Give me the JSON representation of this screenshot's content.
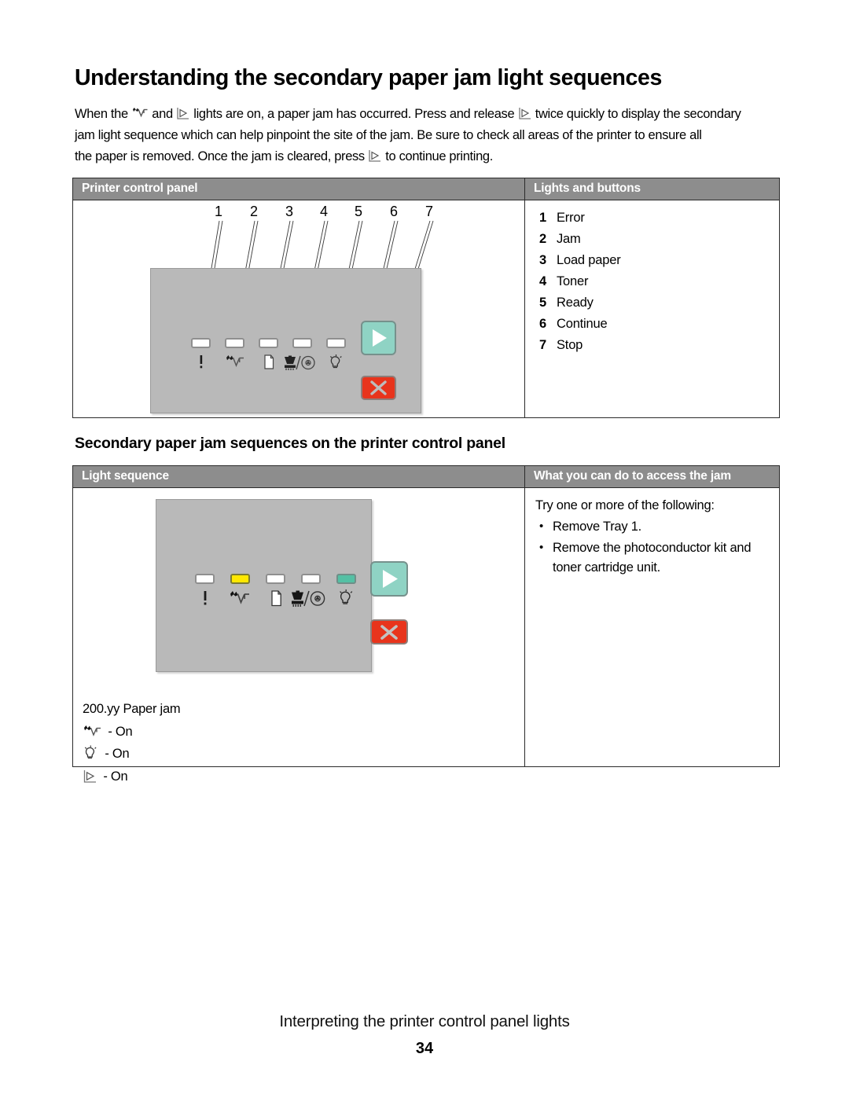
{
  "document": {
    "heading": "Understanding the secondary paper jam light sequences",
    "subheading": "Secondary paper jam sequences on the printer control panel",
    "intro_lines": [
      {
        "pre": "When the ",
        "icon1": "jam-icon",
        "mid1": " and ",
        "icon2": "continue-icon",
        "mid2": " lights are on, a paper jam has occurred. Press and release ",
        "icon3": "continue-icon",
        "post": " twice quickly to display the secondary"
      },
      {
        "text": "jam light sequence which can help pinpoint the site of the jam. Be sure to check all areas of the printer to ensure all"
      },
      {
        "pre2": "the paper is removed. Once the jam is cleared, press ",
        "icon4": "continue-icon",
        "post2": " to continue printing."
      }
    ],
    "footer_text": "Interpreting the printer control panel lights",
    "page_number": "34"
  },
  "panel_table": {
    "headers": {
      "col1": "Printer control panel",
      "col2": "Lights and buttons"
    },
    "callout_numbers": [
      "1",
      "2",
      "3",
      "4",
      "5",
      "6",
      "7"
    ],
    "legend": [
      {
        "num": "1",
        "label": "Error"
      },
      {
        "num": "2",
        "label": "Jam"
      },
      {
        "num": "3",
        "label": "Load paper"
      },
      {
        "num": "4",
        "label": "Toner"
      },
      {
        "num": "5",
        "label": "Ready"
      },
      {
        "num": "6",
        "label": "Continue"
      },
      {
        "num": "7",
        "label": "Stop"
      }
    ],
    "lamp_icons": [
      "error-icon",
      "jam-icon",
      "load-paper-icon",
      "toner-icon",
      "ready-icon"
    ],
    "buttons": [
      "continue-button",
      "stop-button"
    ]
  },
  "sequence_table": {
    "headers": {
      "col1": "Light sequence",
      "col2": "What you can do to access the jam"
    },
    "lamp_states": [
      "off",
      "on-yellow",
      "off",
      "off",
      "on-teal"
    ],
    "caption": {
      "code": "200.yy Paper jam",
      "states": [
        {
          "icon": "jam-icon",
          "text": " - On"
        },
        {
          "icon": "ready-icon",
          "text": " - On"
        },
        {
          "icon": "continue-icon",
          "text": " - On"
        }
      ]
    },
    "action": {
      "lead": "Try one or more of the following:",
      "bullets": [
        "Remove Tray 1.",
        "Remove the photoconductor kit and toner cartridge unit."
      ]
    }
  },
  "colors": {
    "header_gray": "#8d8d8d",
    "panel_gray": "#b9b9b9",
    "lamp_yellow": "#ffe800",
    "lamp_teal": "#54c0a4",
    "continue_button": "#8fd3c4",
    "stop_button": "#e8341c",
    "border": "#2b2b2b"
  }
}
